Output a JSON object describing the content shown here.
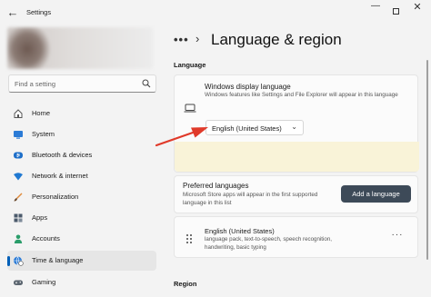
{
  "window": {
    "app_title": "Settings"
  },
  "sidebar": {
    "search_placeholder": "Find a setting",
    "items": [
      {
        "label": "Home",
        "icon": "home-icon"
      },
      {
        "label": "System",
        "icon": "monitor-icon"
      },
      {
        "label": "Bluetooth & devices",
        "icon": "bluetooth-icon"
      },
      {
        "label": "Network & internet",
        "icon": "wifi-icon"
      },
      {
        "label": "Personalization",
        "icon": "brush-icon"
      },
      {
        "label": "Apps",
        "icon": "apps-icon"
      },
      {
        "label": "Accounts",
        "icon": "person-icon"
      },
      {
        "label": "Time & language",
        "icon": "globe-clock-icon",
        "active": true
      },
      {
        "label": "Gaming",
        "icon": "gamepad-icon"
      }
    ]
  },
  "header": {
    "more": "•••",
    "chevron": "›",
    "title": "Language & region"
  },
  "language_section": {
    "label": "Language",
    "display_language": {
      "title": "Windows display language",
      "description": "Windows features like Settings and File Explorer will appear in this language",
      "selected": "English (United States)"
    },
    "preferred": {
      "title": "Preferred languages",
      "description": "Microsoft Store apps will appear in the first supported language in this list",
      "button": "Add a language"
    },
    "installed": [
      {
        "name": "English (United States)",
        "features": "language pack, text-to-speech, speech recognition, handwriting, basic typing"
      }
    ]
  },
  "region_section": {
    "label": "Region"
  },
  "colors": {
    "accent": "#005fb8",
    "button": "#3d4a58",
    "arrow": "#e03a2a",
    "highlight": "#f9f3d8"
  }
}
